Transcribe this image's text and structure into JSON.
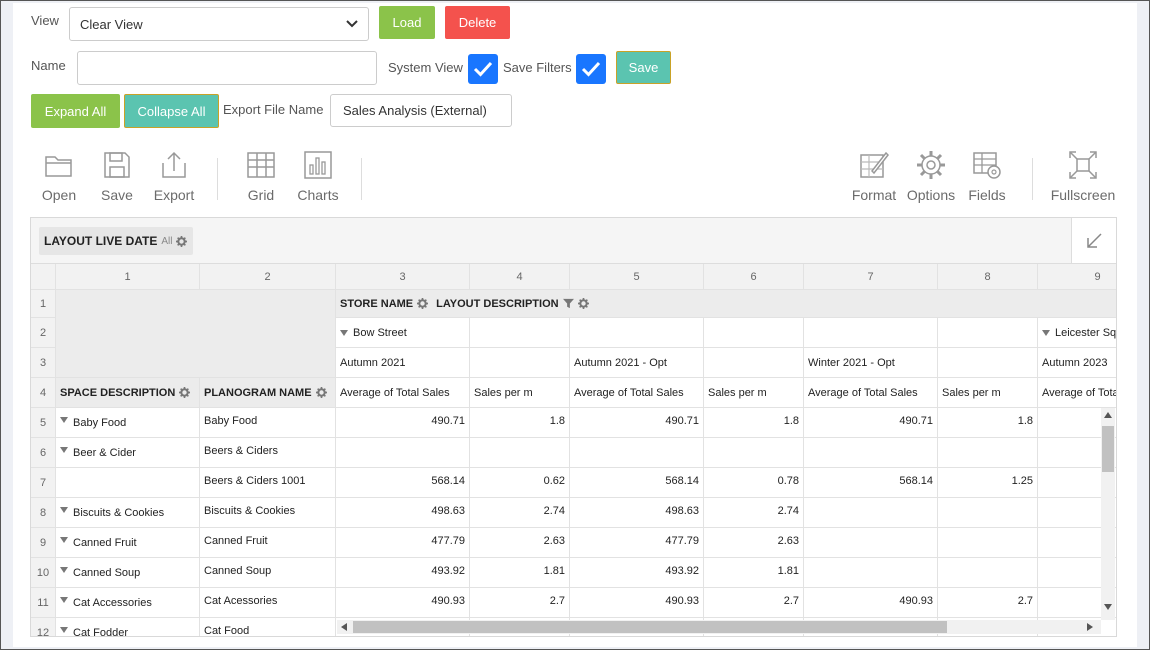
{
  "view": {
    "label": "View",
    "selected": "Clear View",
    "load_label": "Load",
    "delete_label": "Delete"
  },
  "name_row": {
    "label": "Name",
    "value": "",
    "system_view_label": "System View",
    "system_view_checked": true,
    "save_filters_label": "Save Filters",
    "save_filters_checked": true,
    "save_label": "Save"
  },
  "export_row": {
    "expand_label": "Expand All",
    "collapse_label": "Collapse All",
    "export_file_label": "Export File Name",
    "export_file_value": "Sales Analysis (External)"
  },
  "toolbar": {
    "open": "Open",
    "save": "Save",
    "export": "Export",
    "grid": "Grid",
    "charts": "Charts",
    "format": "Format",
    "options": "Options",
    "fields": "Fields",
    "fullscreen": "Fullscreen"
  },
  "pivot": {
    "filter_field": "LAYOUT LIVE DATE",
    "filter_value": "All",
    "col_numbers": [
      "1",
      "2",
      "3",
      "4",
      "5",
      "6",
      "7",
      "8",
      "9"
    ],
    "row_numbers": [
      "1",
      "2",
      "3",
      "4",
      "5",
      "6",
      "7",
      "8",
      "9",
      "10",
      "11",
      "12"
    ],
    "col_fields": [
      "STORE NAME",
      "LAYOUT DESCRIPTION"
    ],
    "stores": [
      "Bow Street",
      "Leicester Squ"
    ],
    "layouts": [
      "Autumn 2021",
      "Autumn 2021 - Opt",
      "Winter 2021 - Opt",
      "Autumn 2023"
    ],
    "row_fields": [
      "SPACE DESCRIPTION",
      "PLANOGRAM NAME"
    ],
    "measures": [
      "Average of Total Sales",
      "Sales per m",
      "Average of Total Sales",
      "Sales per m",
      "Average of Total Sales",
      "Sales per m",
      "Average of Tota"
    ],
    "rows": [
      {
        "space": "Baby Food",
        "planogram": "Baby Food",
        "v": [
          "490.71",
          "1.8",
          "490.71",
          "1.8",
          "490.71",
          "1.8"
        ]
      },
      {
        "space": "Beer & Cider",
        "planogram": "Beers & Ciders",
        "v": [
          "",
          "",
          "",
          "",
          "",
          ""
        ]
      },
      {
        "space": "",
        "planogram": "Beers & Ciders 1001",
        "v": [
          "568.14",
          "0.62",
          "568.14",
          "0.78",
          "568.14",
          "1.25"
        ]
      },
      {
        "space": "Biscuits & Cookies",
        "planogram": "Biscuits & Cookies",
        "v": [
          "498.63",
          "2.74",
          "498.63",
          "2.74",
          "",
          ""
        ]
      },
      {
        "space": "Canned Fruit",
        "planogram": "Canned Fruit",
        "v": [
          "477.79",
          "2.63",
          "477.79",
          "2.63",
          "",
          ""
        ]
      },
      {
        "space": "Canned Soup",
        "planogram": "Canned Soup",
        "v": [
          "493.92",
          "1.81",
          "493.92",
          "1.81",
          "",
          ""
        ]
      },
      {
        "space": "Cat Accessories",
        "planogram": "Cat Acessories",
        "v": [
          "490.93",
          "2.7",
          "490.93",
          "2.7",
          "490.93",
          "2.7"
        ]
      },
      {
        "space": "Cat Fodder",
        "planogram": "Cat Food",
        "v": [
          "",
          "",
          "",
          "",
          "",
          ""
        ]
      }
    ]
  }
}
